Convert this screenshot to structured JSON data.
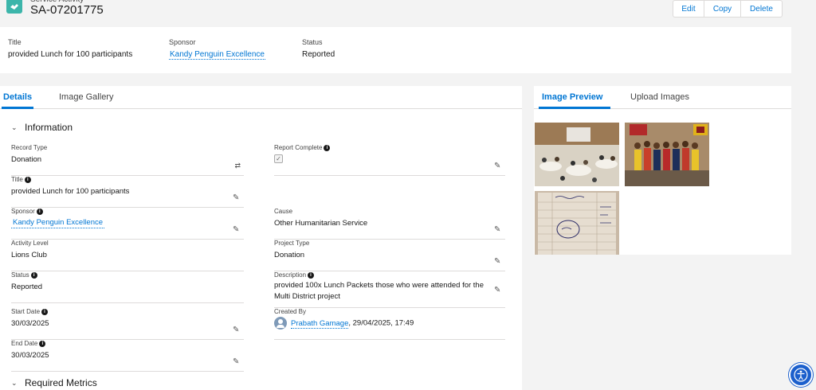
{
  "header": {
    "object_type": "Service Activity",
    "record_name": "SA-07201775",
    "buttons": {
      "edit": "Edit",
      "copy": "Copy",
      "delete": "Delete"
    }
  },
  "highlights": {
    "title_label": "Title",
    "title_value": "provided Lunch for 100 participants",
    "sponsor_label": "Sponsor",
    "sponsor_value": "Kandy Penguin Excellence",
    "status_label": "Status",
    "status_value": "Reported"
  },
  "left_tabs": {
    "details": "Details",
    "gallery": "Image Gallery"
  },
  "sections": {
    "information": "Information",
    "required_metrics": "Required Metrics"
  },
  "fields": {
    "record_type": {
      "label": "Record Type",
      "value": "Donation"
    },
    "report_complete": {
      "label": "Report Complete",
      "checked": true
    },
    "title": {
      "label": "Title",
      "value": "provided Lunch for 100 participants"
    },
    "sponsor": {
      "label": "Sponsor",
      "value": "Kandy Penguin Excellence"
    },
    "cause": {
      "label": "Cause",
      "value": "Other Humanitarian Service"
    },
    "activity_level": {
      "label": "Activity Level",
      "value": "Lions Club"
    },
    "project_type": {
      "label": "Project Type",
      "value": "Donation"
    },
    "status": {
      "label": "Status",
      "value": "Reported"
    },
    "description": {
      "label": "Description",
      "value": "provided 100x Lunch Packets those who were attended for the Multi District project"
    },
    "start_date": {
      "label": "Start Date",
      "value": "30/03/2025"
    },
    "created_by": {
      "label": "Created By",
      "user": "Prabath Gamage",
      "timestamp": ", 29/04/2025, 17:49"
    },
    "end_date": {
      "label": "End Date",
      "value": "30/03/2025"
    }
  },
  "right_tabs": {
    "preview": "Image Preview",
    "upload": "Upload Images"
  },
  "colors": {
    "brand": "#0176d3",
    "object_icon": "#3cb5aa",
    "accessibility": "#1b5fcc"
  },
  "icons": [
    "service-activity-icon",
    "info-icon",
    "pencil-icon",
    "change-record-type-icon",
    "chevron-down-icon",
    "user-avatar-icon",
    "accessibility-icon"
  ]
}
